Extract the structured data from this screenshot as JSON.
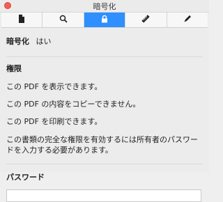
{
  "window": {
    "title": "暗号化"
  },
  "tabs": [
    {
      "icon": "document-icon"
    },
    {
      "icon": "search-icon"
    },
    {
      "icon": "lock-icon",
      "active": true
    },
    {
      "icon": "ruler-icon"
    },
    {
      "icon": "pencil-icon"
    }
  ],
  "encryption": {
    "label": "暗号化",
    "value": "はい"
  },
  "permissions": {
    "title": "権限",
    "items": [
      "この PDF を表示できます。",
      "この PDF の内容をコピーできません。",
      "この PDF を印刷できます。",
      "この書類の完全な権限を有効するには所有者のパスワードを入力する必要があります。"
    ]
  },
  "password": {
    "title": "パスワード",
    "value": "",
    "placeholder": ""
  },
  "colors": {
    "accent": "#2e8fff",
    "close": "#f25d56"
  }
}
